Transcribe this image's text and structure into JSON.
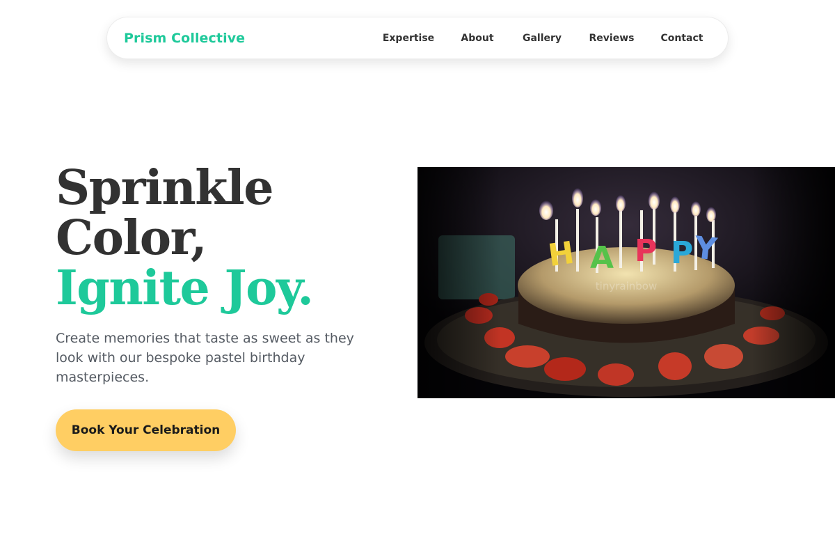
{
  "header": {
    "brand": "Prism Collective",
    "nav": [
      {
        "label": "Expertise"
      },
      {
        "label": "About"
      },
      {
        "label": "Gallery"
      },
      {
        "label": "Reviews"
      },
      {
        "label": "Contact"
      }
    ]
  },
  "hero": {
    "title_line1": "Sprinkle",
    "title_line2": "Color,",
    "title_accent": "Ignite Joy.",
    "subtitle": "Create memories that taste as sweet as they look with our bespoke pastel birthday masterpieces.",
    "cta_label": "Book Your Celebration",
    "image": {
      "subject": "birthday cake with lit HAPPY letter candles and strawberries",
      "candle_letters": [
        "H",
        "A",
        "P",
        "P",
        "Y"
      ],
      "watermark": "tinyrainbow"
    }
  },
  "colors": {
    "accent": "#1ec99a",
    "cta_bg": "#ffce63",
    "heading": "#323232",
    "body_text": "#555b63"
  }
}
